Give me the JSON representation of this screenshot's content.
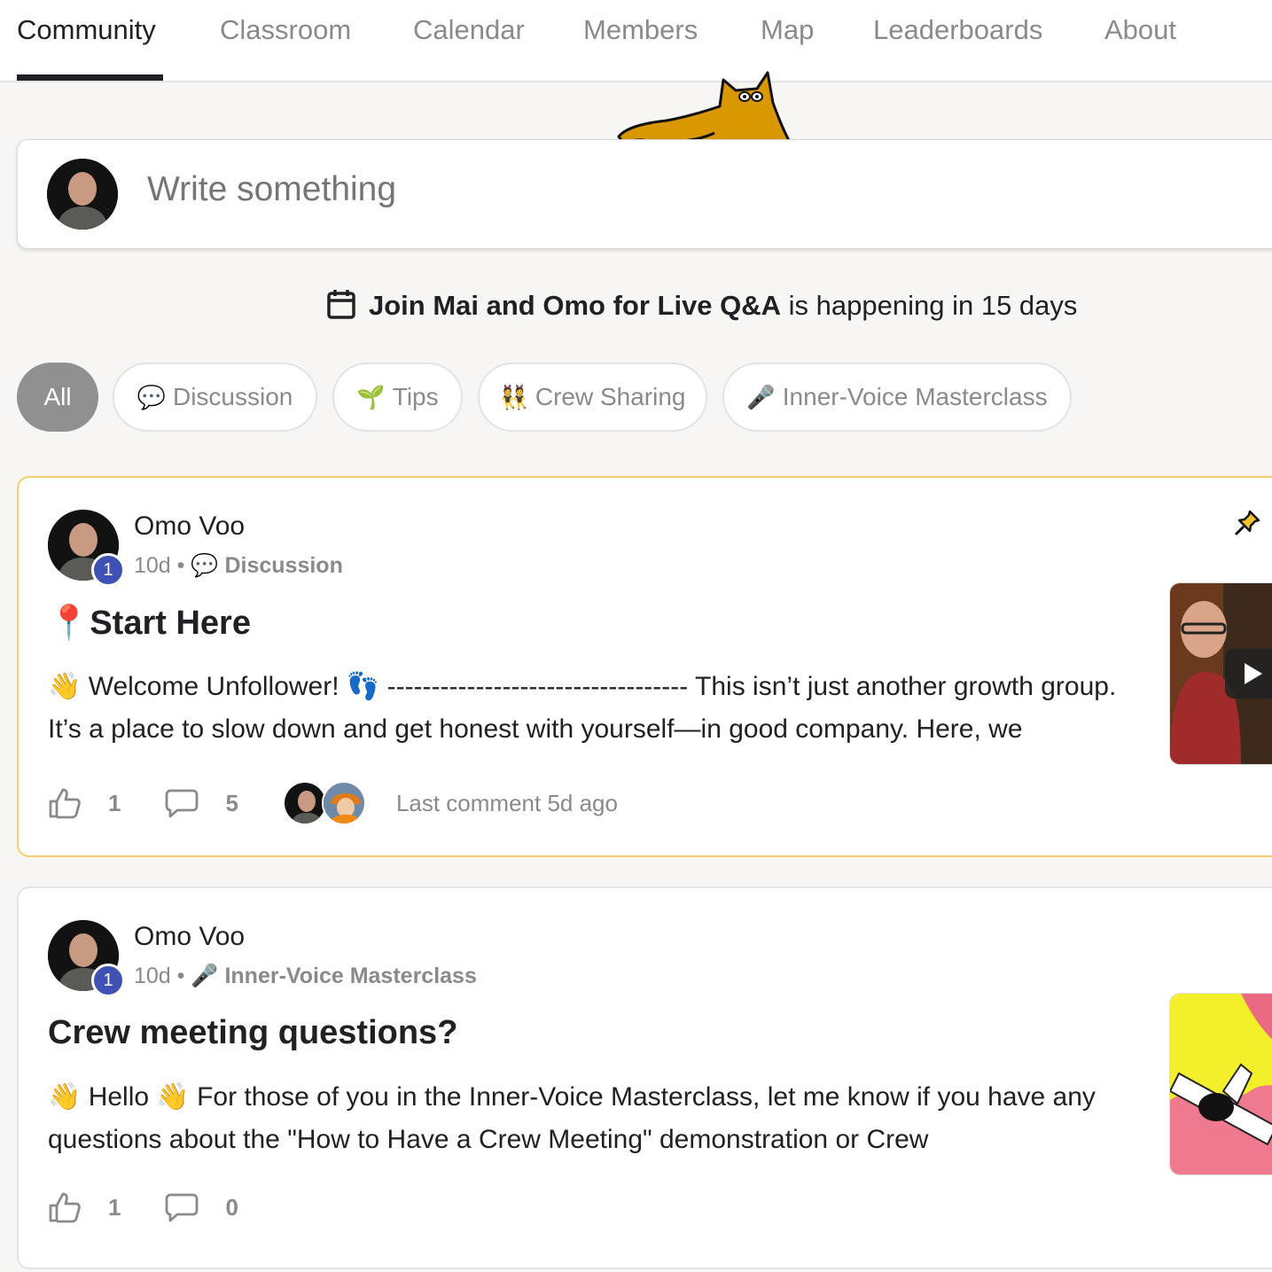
{
  "nav": {
    "tabs": [
      {
        "label": "Community",
        "active": true
      },
      {
        "label": "Classroom"
      },
      {
        "label": "Calendar"
      },
      {
        "label": "Members"
      },
      {
        "label": "Map"
      },
      {
        "label": "Leaderboards"
      },
      {
        "label": "About"
      }
    ]
  },
  "composer": {
    "placeholder": "Write something"
  },
  "event": {
    "name": "Join Mai and Omo for Live Q&A",
    "suffix": " is happening in 15 days"
  },
  "filters": [
    {
      "label": "All",
      "emoji": "",
      "active": true
    },
    {
      "label": "Discussion",
      "emoji": "💬"
    },
    {
      "label": "Tips",
      "emoji": "🌱"
    },
    {
      "label": "Crew Sharing",
      "emoji": "👯"
    },
    {
      "label": "Inner-Voice Masterclass",
      "emoji": "🎤"
    }
  ],
  "posts": [
    {
      "pinned": true,
      "author": "Omo Voo",
      "level": "1",
      "time": "10d",
      "category_emoji": "💬",
      "category": "Discussion",
      "title_emoji": "📍",
      "title": "Start Here",
      "body": "👋 Welcome Unfollower! 👣 ---------------------------------- This isn’t just another growth group. It’s a place to slow down and get honest with yourself—in good company. Here, we",
      "likes": "1",
      "comments": "5",
      "last_comment": "Last comment 5d ago",
      "thumbnail": "video-thumbnail"
    },
    {
      "pinned": false,
      "author": "Omo Voo",
      "level": "1",
      "time": "10d",
      "category_emoji": "🎤",
      "category": "Inner-Voice Masterclass",
      "title": "Crew meeting questions?",
      "body": "👋 Hello 👋 For those of you in the Inner-Voice Masterclass, let me know if you have any questions about the \"How to Have a Crew Meeting\" demonstration or Crew",
      "likes": "1",
      "comments": "0",
      "thumbnail": "illustration-thumbnail"
    }
  ],
  "colors": {
    "badge": "#3f51b5",
    "pinned_border": "#f6cf6a",
    "cat": "#d99700"
  }
}
